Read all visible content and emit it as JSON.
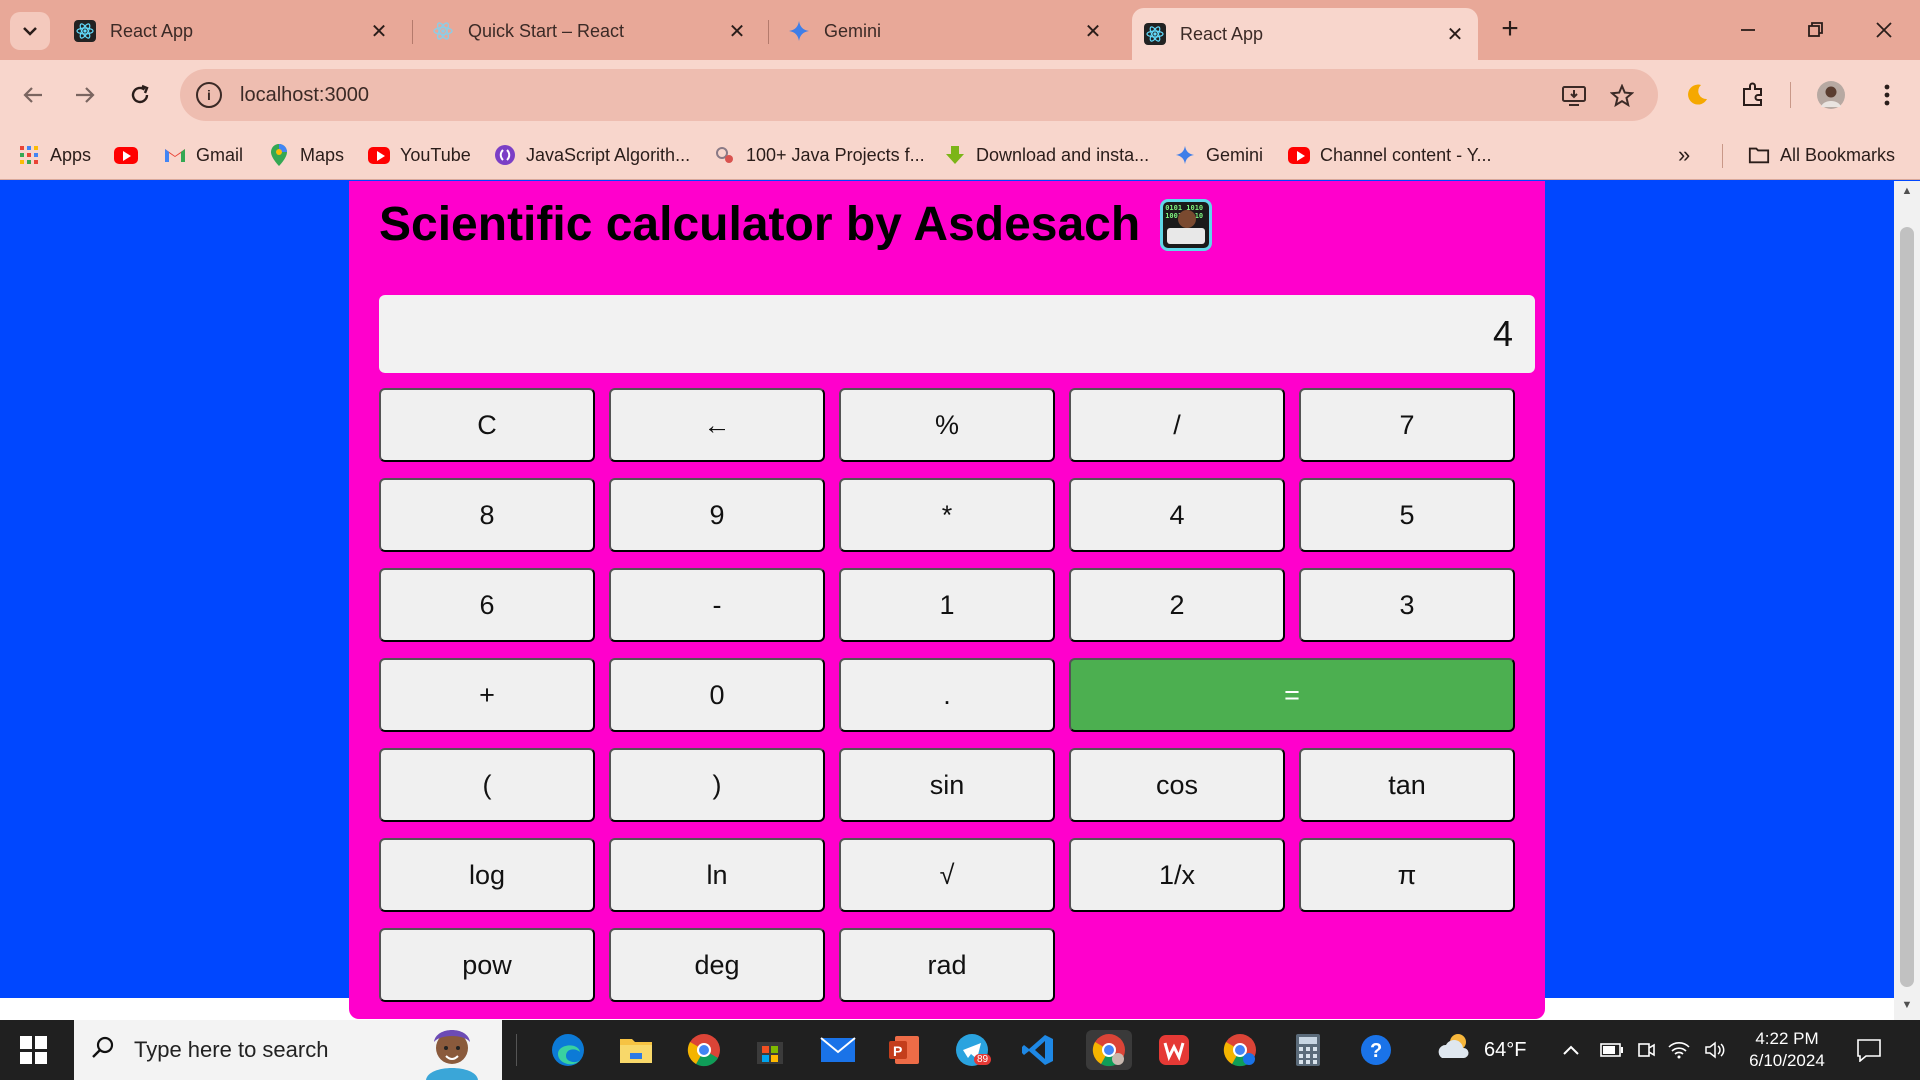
{
  "browser": {
    "tabs": [
      {
        "label": "React App",
        "active": false
      },
      {
        "label": "Quick Start – React",
        "active": false
      },
      {
        "label": "Gemini",
        "active": false
      },
      {
        "label": "React App",
        "active": true
      }
    ],
    "url": "localhost:3000",
    "bookmarks": [
      {
        "label": "Apps",
        "icon": "apps-grid-icon"
      },
      {
        "label": "",
        "icon": "youtube-icon"
      },
      {
        "label": "Gmail",
        "icon": "gmail-icon"
      },
      {
        "label": "Maps",
        "icon": "maps-pin-icon"
      },
      {
        "label": "YouTube",
        "icon": "youtube-icon"
      },
      {
        "label": "JavaScript Algorith...",
        "icon": "freecodecamp-icon"
      },
      {
        "label": "100+ Java Projects f...",
        "icon": "java-icon"
      },
      {
        "label": "Download and insta...",
        "icon": "download-icon"
      },
      {
        "label": "Gemini",
        "icon": "gemini-icon"
      },
      {
        "label": "Channel content - Y...",
        "icon": "youtube-icon"
      }
    ],
    "all_bookmarks": "All Bookmarks",
    "more_bookmarks": "»"
  },
  "calculator": {
    "title": "Scientific calculator by Asdesach",
    "display": "4",
    "keys": [
      "C",
      "←",
      "%",
      "/",
      "7",
      "8",
      "9",
      "*",
      "4",
      "5",
      "6",
      "-",
      "1",
      "2",
      "3",
      "+",
      "0",
      ".",
      "=",
      "(",
      ")",
      "sin",
      "cos",
      "tan",
      "log",
      "ln",
      "√",
      "1/x",
      "π",
      "pow",
      "deg",
      "rad"
    ],
    "equals_color": "#4caf50",
    "panel_color": "#ff00cc",
    "page_background": "#0047ff"
  },
  "taskbar": {
    "search_placeholder": "Type here to search",
    "weather": "64°F",
    "time": "4:22 PM",
    "date": "6/10/2024",
    "telegram_badge": "89"
  }
}
